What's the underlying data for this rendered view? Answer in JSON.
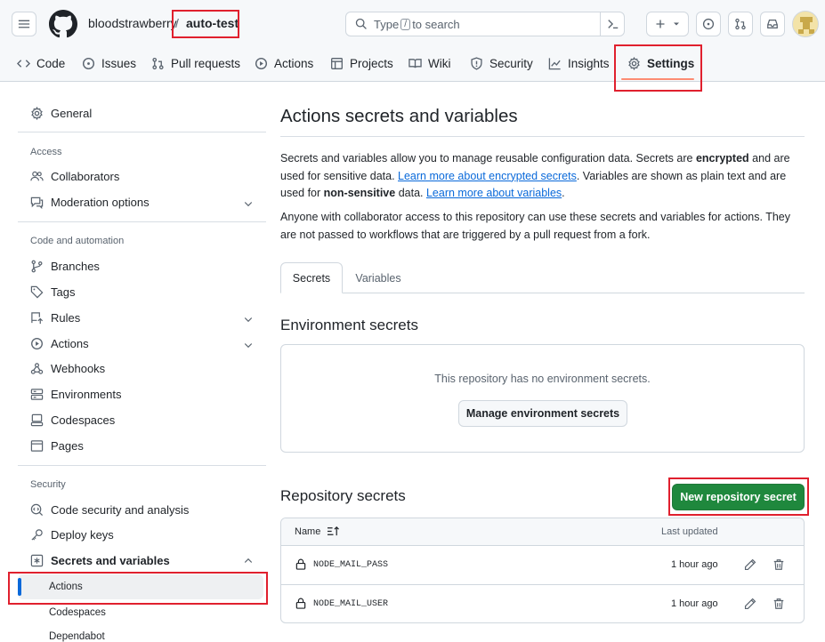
{
  "header": {
    "owner": "bloodstrawberry",
    "separator": "/",
    "repo": "auto-test",
    "search": {
      "prefix": "Type",
      "key": "/",
      "suffix": "to search"
    },
    "icons": [
      "menu-icon",
      "github-logo-icon",
      "terminal-icon",
      "plus-icon",
      "chevron-down-icon",
      "issue-icon",
      "pull-request-icon",
      "inbox-icon",
      "avatar"
    ]
  },
  "nav": {
    "tabs": [
      {
        "label": "Code",
        "icon": "code-icon"
      },
      {
        "label": "Issues",
        "icon": "issue-icon"
      },
      {
        "label": "Pull requests",
        "icon": "pull-request-icon"
      },
      {
        "label": "Actions",
        "icon": "play-icon"
      },
      {
        "label": "Projects",
        "icon": "table-icon"
      },
      {
        "label": "Wiki",
        "icon": "book-icon"
      },
      {
        "label": "Security",
        "icon": "shield-icon"
      },
      {
        "label": "Insights",
        "icon": "graph-icon"
      },
      {
        "label": "Settings",
        "icon": "gear-icon"
      }
    ],
    "selected": "Settings"
  },
  "sidebar": {
    "general": "General",
    "access_heading": "Access",
    "collaborators": "Collaborators",
    "moderation": "Moderation options",
    "code_heading": "Code and automation",
    "branches": "Branches",
    "tags": "Tags",
    "rules": "Rules",
    "actions": "Actions",
    "webhooks": "Webhooks",
    "environments": "Environments",
    "codespaces": "Codespaces",
    "pages": "Pages",
    "security_heading": "Security",
    "code_security": "Code security and analysis",
    "deploy_keys": "Deploy keys",
    "secrets_vars": "Secrets and variables",
    "sub_actions": "Actions",
    "sub_codespaces": "Codespaces",
    "sub_dependabot": "Dependabot"
  },
  "main": {
    "title": "Actions secrets and variables",
    "intro": {
      "p1_a": "Secrets and variables allow you to manage reusable configuration data. Secrets are ",
      "p1_b": "encrypted",
      "p1_c": " and are used for sensitive data. ",
      "p1_link1": "Learn more about encrypted secrets",
      "p1_d": ". Variables are shown as plain text and are used for ",
      "p1_e": "non-sensitive",
      "p1_f": " data. ",
      "p1_link2": "Learn more about variables",
      "p1_g": ".",
      "p2": "Anyone with collaborator access to this repository can use these secrets and variables for actions. They are not passed to workflows that are triggered by a pull request from a fork."
    },
    "tabs": {
      "secrets": "Secrets",
      "variables": "Variables",
      "selected": "Secrets"
    },
    "env": {
      "heading": "Environment secrets",
      "empty": "This repository has no environment secrets.",
      "button": "Manage environment secrets"
    },
    "repo": {
      "heading": "Repository secrets",
      "new_button": "New repository secret",
      "col_name": "Name",
      "col_updated": "Last updated",
      "rows": [
        {
          "name": "NODE_MAIL_PASS",
          "updated": "1 hour ago"
        },
        {
          "name": "NODE_MAIL_USER",
          "updated": "1 hour ago"
        }
      ]
    }
  },
  "colors": {
    "accent": "#0969da",
    "selected_underline": "#fd8c73",
    "primary_button": "#1f883d",
    "highlight": "#e0202e"
  }
}
